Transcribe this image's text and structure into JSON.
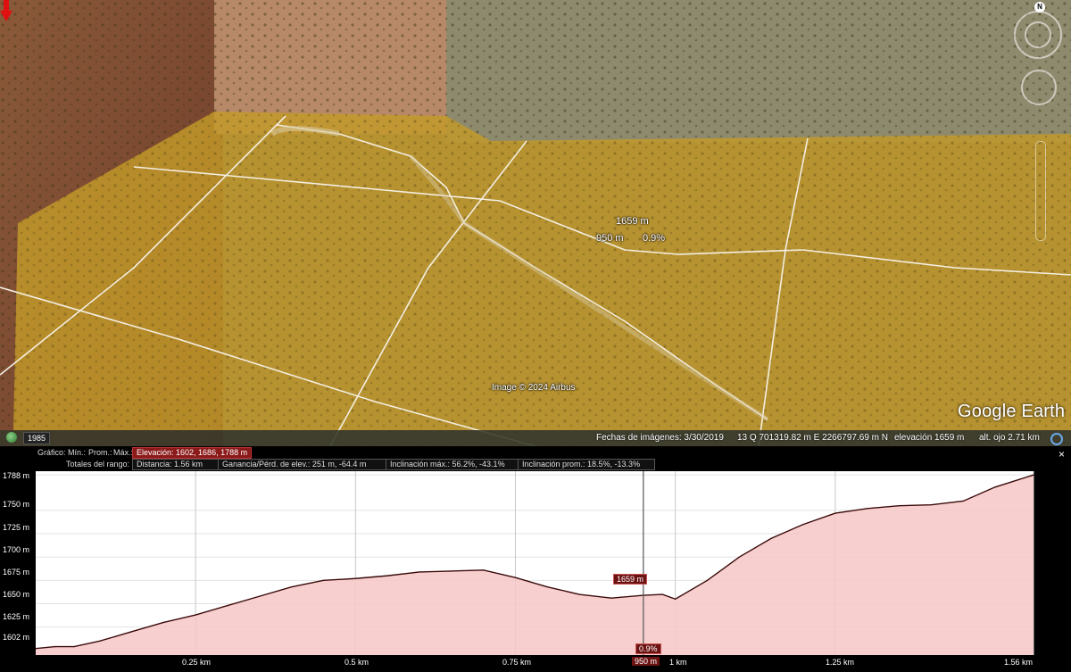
{
  "map": {
    "marker_elevation": "1659 m",
    "marker_distance": "950 m",
    "marker_grade": "0.9%",
    "imagery_credit": "Image © 2024 Airbus",
    "logo": "Google Earth",
    "north_label": "N",
    "year_badge": "1985",
    "icons": [
      "globe-icon",
      "north-compass-icon",
      "look-ring-icon",
      "move-ring-icon",
      "zoom-slider-icon",
      "placemark-arrow-icon",
      "status-circle-icon",
      "close-icon"
    ]
  },
  "status_bar": {
    "imagery_date": "Fechas de imágenes: 3/30/2019",
    "coordinates": "13 Q 701319.82 m E 2266797.69 m N",
    "elevation": "elevación  1659 m",
    "eye_alt": "alt. ojo    2.71 km"
  },
  "profile": {
    "row1": {
      "label": "Gráfico:",
      "min": "Mín.:",
      "avg": "Prom.:",
      "max": "Máx.:",
      "elevation": "Elevación: 1602, 1686, 1788 m"
    },
    "row2": {
      "label": "Totales del rango:",
      "distance": "Distancia: 1.56 km",
      "gain_loss": "Ganancia/Pérd. de elev.: 251 m, -64.4 m",
      "max_slope": "Inclinación máx.: 56.2%, -43.1%",
      "avg_slope": "Inclinación prom.: 18.5%, -13.3%"
    },
    "cursor": {
      "elevation": "1659 m",
      "grade": "0.9%",
      "distance": "950 m"
    },
    "close_label": "×"
  },
  "chart_data": {
    "type": "area",
    "title": "",
    "xlabel": "",
    "ylabel": "",
    "x_unit": "km",
    "ylim": [
      1595,
      1792
    ],
    "xlim": [
      0,
      1.56
    ],
    "y_ticks": [
      "1788 m",
      "1750 m",
      "1725 m",
      "1700 m",
      "1675 m",
      "1650 m",
      "1625 m",
      "1602 m"
    ],
    "x_ticks": [
      "0.25 km",
      "0.5 km",
      "0.75 km",
      "1 km",
      "1.25 km",
      "1.56 km"
    ],
    "x": [
      0,
      0.03,
      0.06,
      0.1,
      0.15,
      0.2,
      0.25,
      0.3,
      0.35,
      0.4,
      0.45,
      0.5,
      0.55,
      0.6,
      0.65,
      0.7,
      0.75,
      0.8,
      0.85,
      0.9,
      0.95,
      0.98,
      1.0,
      1.05,
      1.1,
      1.15,
      1.2,
      1.25,
      1.3,
      1.35,
      1.4,
      1.45,
      1.5,
      1.56
    ],
    "y": [
      1602,
      1604,
      1604,
      1610,
      1620,
      1630,
      1638,
      1648,
      1658,
      1668,
      1675,
      1677,
      1680,
      1684,
      1685,
      1686,
      1678,
      1668,
      1660,
      1656,
      1659,
      1660,
      1655,
      1675,
      1700,
      1720,
      1735,
      1747,
      1752,
      1755,
      1756,
      1760,
      1775,
      1788
    ],
    "fill_color": "#f7c7c7",
    "line_color": "#3a0a0a",
    "cursor_x": 0.95,
    "grid": true
  }
}
